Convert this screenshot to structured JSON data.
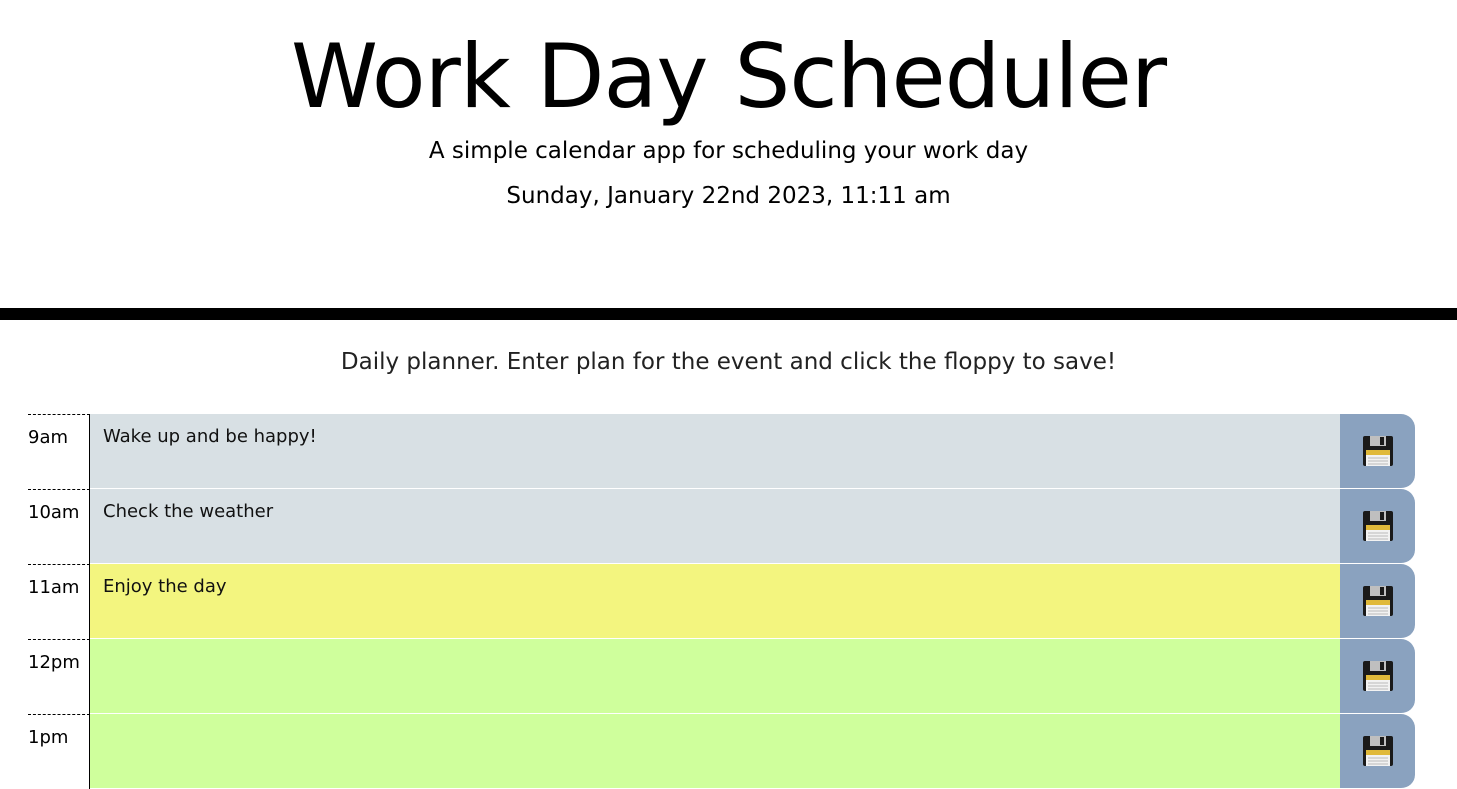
{
  "header": {
    "title": "Work Day Scheduler",
    "subtitle": "A simple calendar app for scheduling your work day",
    "current_datetime": "Sunday, January 22nd 2023, 11:11 am"
  },
  "planner": {
    "instructions": "Daily planner. Enter plan for the event and click the floppy to save!",
    "rows": [
      {
        "hour": "9am",
        "text": "Wake up and be happy!",
        "state": "past"
      },
      {
        "hour": "10am",
        "text": "Check the weather",
        "state": "past"
      },
      {
        "hour": "11am",
        "text": "Enjoy the day",
        "state": "present"
      },
      {
        "hour": "12pm",
        "text": "",
        "state": "future"
      },
      {
        "hour": "1pm",
        "text": "",
        "state": "future"
      }
    ],
    "save_icon": "floppy-disk-icon"
  },
  "colors": {
    "past": "#d8e0e4",
    "present": "#f3f57f",
    "future": "#cfff9c",
    "save_button": "#8aa2bf",
    "divider": "#000000"
  }
}
